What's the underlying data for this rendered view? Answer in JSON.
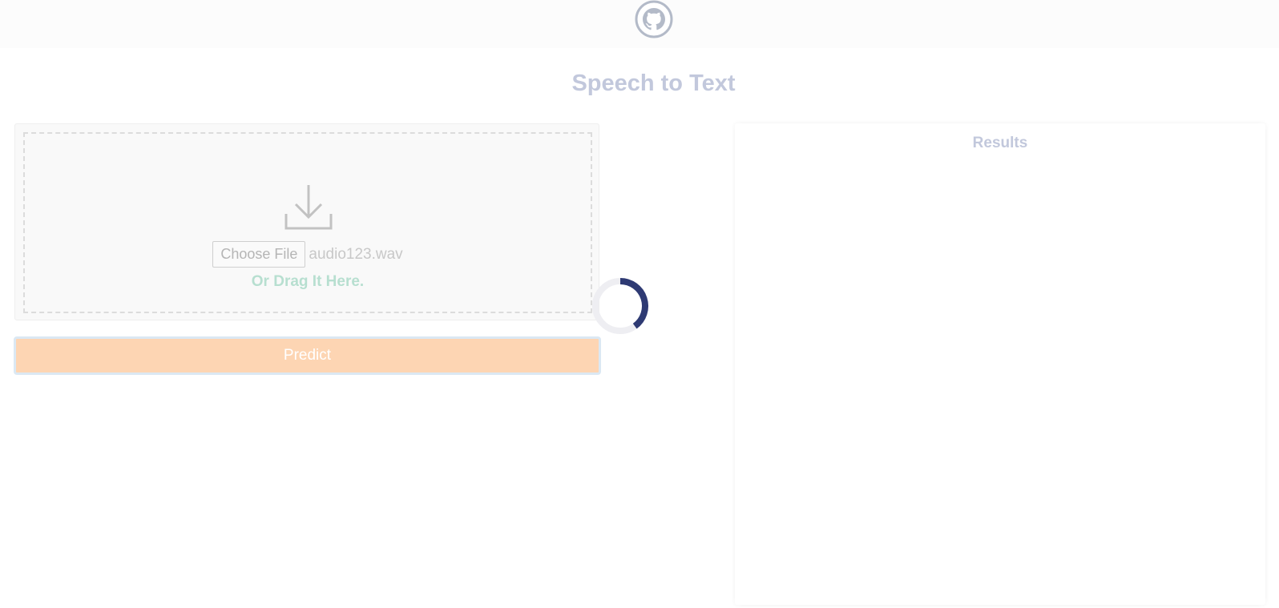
{
  "header": {
    "github_icon": "github-icon"
  },
  "page": {
    "title": "Speech to Text"
  },
  "upload": {
    "icon": "download-icon",
    "choose_file_label": "Choose File",
    "file_name": "audio123.wav",
    "drag_hint": "Or Drag It Here."
  },
  "actions": {
    "predict_label": "Predict"
  },
  "loading": {
    "spinner_icon": "spinner-icon",
    "color": "#2e3a73"
  },
  "results": {
    "title": "Results"
  },
  "colors": {
    "title": "#c2c8dc",
    "predict_bg": "#fdd5b3",
    "drag_hint": "#b7dfd0"
  }
}
